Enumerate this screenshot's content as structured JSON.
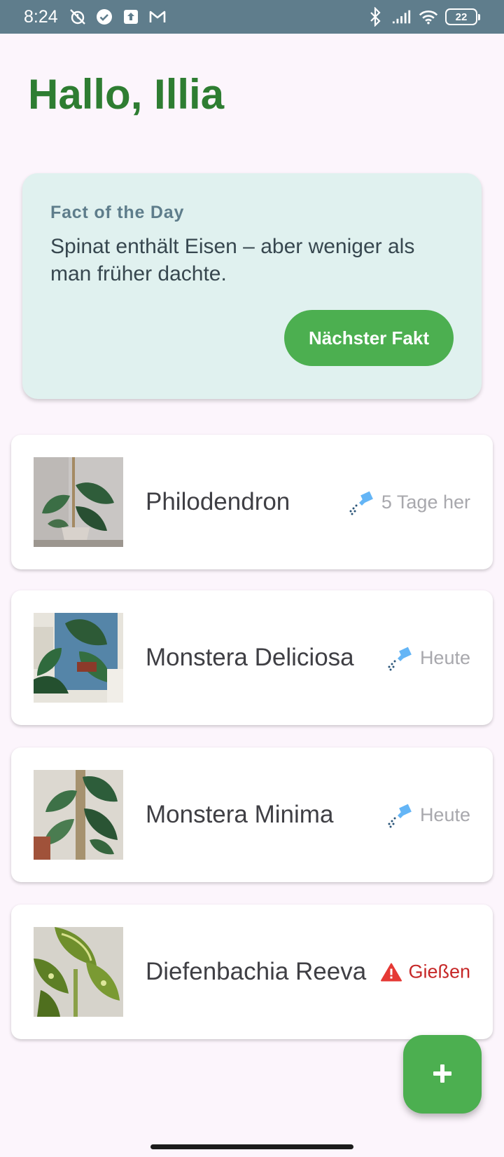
{
  "status_bar": {
    "time": "8:24",
    "battery": "22"
  },
  "greeting": "Hallo, Illia",
  "fact_card": {
    "title": "Fact of the Day",
    "text": "Spinat enthält Eisen – aber weniger als man früher dachte.",
    "button_label": "Nächster Fakt"
  },
  "plants": [
    {
      "name": "Philodendron",
      "status": "5 Tage her",
      "status_icon": "watering-can-icon"
    },
    {
      "name": "Monstera Deliciosa",
      "status": "Heute",
      "status_icon": "watering-can-icon"
    },
    {
      "name": "Monstera Minima",
      "status": "Heute",
      "status_icon": "watering-can-icon"
    },
    {
      "name": "Diefenbachia Reeva",
      "status": "Gießen",
      "status_icon": "warning-icon"
    }
  ],
  "fab_icon": "plus-icon",
  "colors": {
    "accent": "#4caf50",
    "greeting": "#2e7d32",
    "alert": "#c62828",
    "status_bar": "#5f7d8c"
  }
}
